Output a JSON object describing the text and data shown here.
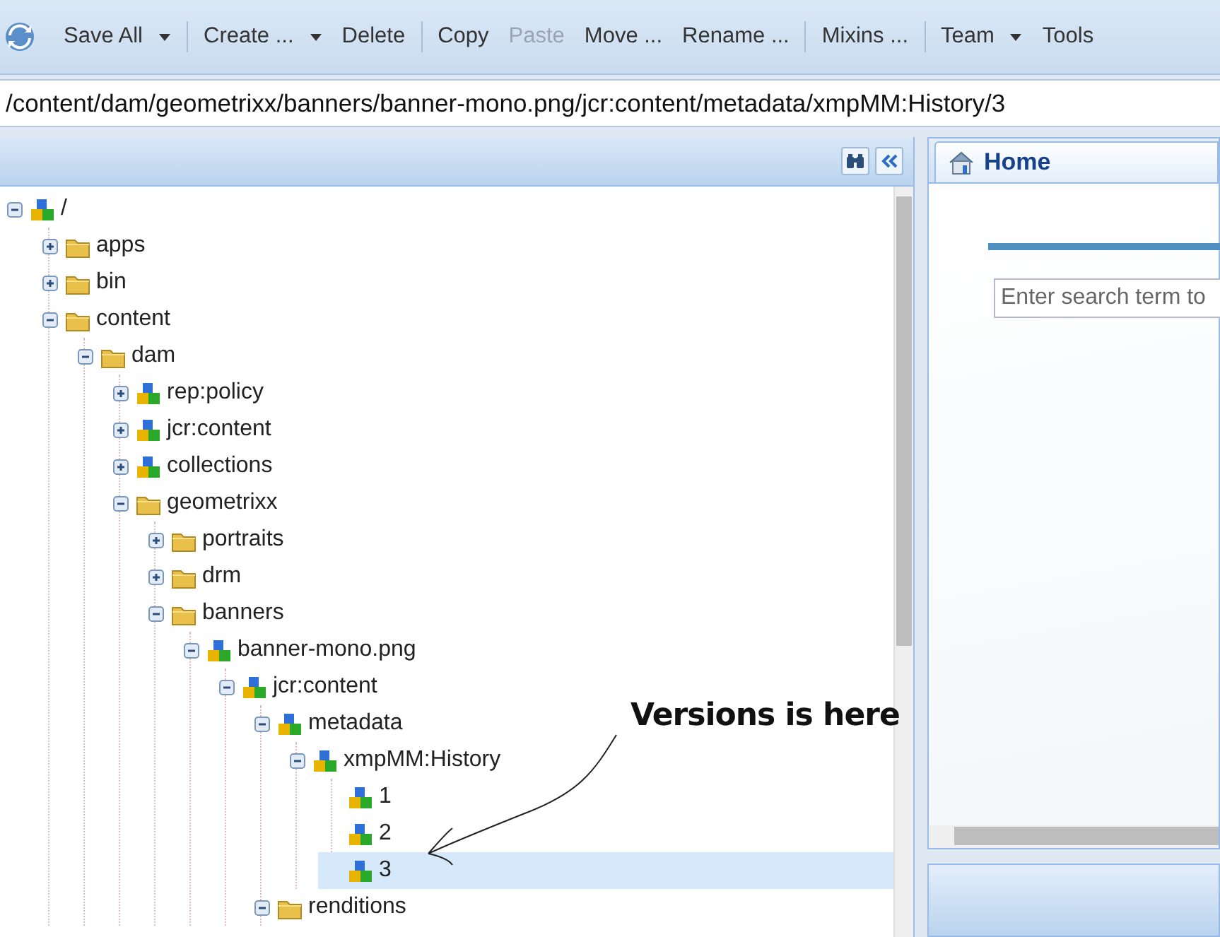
{
  "toolbar": {
    "groups": [
      {
        "items": [
          {
            "label": "Save All",
            "dropdown": true,
            "disabled": false
          }
        ]
      },
      {
        "items": [
          {
            "label": "Create ...",
            "dropdown": true,
            "disabled": false
          },
          {
            "label": "Delete",
            "dropdown": false,
            "disabled": false
          }
        ]
      },
      {
        "items": [
          {
            "label": "Copy",
            "dropdown": false,
            "disabled": false
          },
          {
            "label": "Paste",
            "dropdown": false,
            "disabled": true
          },
          {
            "label": "Move ...",
            "dropdown": false,
            "disabled": false
          },
          {
            "label": "Rename ...",
            "dropdown": false,
            "disabled": false
          }
        ]
      },
      {
        "items": [
          {
            "label": "Mixins ...",
            "dropdown": false,
            "disabled": false
          }
        ]
      },
      {
        "items": [
          {
            "label": "Team",
            "dropdown": true,
            "disabled": false
          },
          {
            "label": "Tools",
            "dropdown": false,
            "disabled": false
          }
        ]
      }
    ]
  },
  "path": "/content/dam/geometrixx/banners/banner-mono.png/jcr:content/metadata/xmpMM:History/3",
  "tree": {
    "items": [
      {
        "label": "/",
        "kind": "node",
        "expanded": true,
        "selected": false,
        "children": [
          {
            "label": "apps",
            "kind": "folder",
            "expanded": false,
            "selected": false
          },
          {
            "label": "bin",
            "kind": "folder",
            "expanded": false,
            "selected": false
          },
          {
            "label": "content",
            "kind": "folder",
            "expanded": true,
            "selected": false,
            "children": [
              {
                "label": "dam",
                "kind": "folder",
                "expanded": true,
                "selected": false,
                "children": [
                  {
                    "label": "rep:policy",
                    "kind": "node",
                    "expanded": false,
                    "selected": false
                  },
                  {
                    "label": "jcr:content",
                    "kind": "node",
                    "expanded": false,
                    "selected": false
                  },
                  {
                    "label": "collections",
                    "kind": "node",
                    "expanded": false,
                    "selected": false
                  },
                  {
                    "label": "geometrixx",
                    "kind": "folder",
                    "expanded": true,
                    "selected": false,
                    "children": [
                      {
                        "label": "portraits",
                        "kind": "folder",
                        "expanded": false,
                        "selected": false
                      },
                      {
                        "label": "drm",
                        "kind": "folder",
                        "expanded": false,
                        "selected": false
                      },
                      {
                        "label": "banners",
                        "kind": "folder",
                        "expanded": true,
                        "selected": false,
                        "children": [
                          {
                            "label": "banner-mono.png",
                            "kind": "node",
                            "expanded": true,
                            "selected": false,
                            "children": [
                              {
                                "label": "jcr:content",
                                "kind": "node",
                                "expanded": true,
                                "selected": false,
                                "children": [
                                  {
                                    "label": "metadata",
                                    "kind": "node",
                                    "expanded": true,
                                    "selected": false,
                                    "children": [
                                      {
                                        "label": "xmpMM:History",
                                        "kind": "node",
                                        "expanded": true,
                                        "selected": false,
                                        "children": [
                                          {
                                            "label": "1",
                                            "kind": "node",
                                            "selected": false
                                          },
                                          {
                                            "label": "2",
                                            "kind": "node",
                                            "selected": false
                                          },
                                          {
                                            "label": "3",
                                            "kind": "node",
                                            "selected": true
                                          }
                                        ]
                                      }
                                    ]
                                  },
                                  {
                                    "label": "renditions",
                                    "kind": "folder",
                                    "expanded": true,
                                    "selected": false
                                  }
                                ]
                              }
                            ]
                          }
                        ]
                      }
                    ]
                  }
                ]
              }
            ]
          }
        ]
      }
    ]
  },
  "home_tab": {
    "title": "Home",
    "search": {
      "placeholder": "Enter search term to"
    }
  },
  "annotation": {
    "text": "Versions is here"
  }
}
